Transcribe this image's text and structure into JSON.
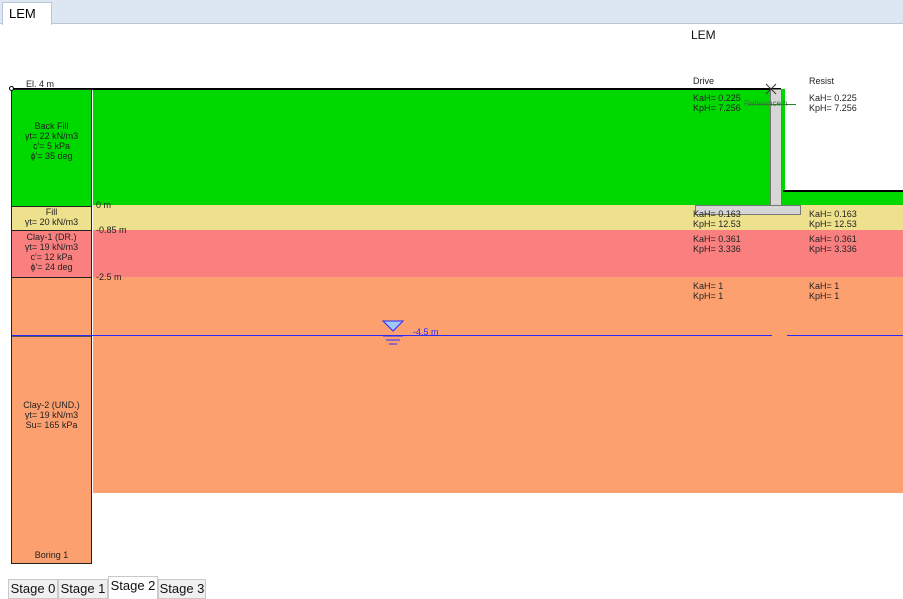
{
  "window": {
    "tab_title": "LEM"
  },
  "canvas": {
    "title": "LEM",
    "elevation_label": "El. 4 m",
    "drive_header": "Drive",
    "resist_header": "Resist",
    "wall_label": "Reference h",
    "water_level_label": "-4.5 m",
    "depth_labels": [
      "0 m",
      "-0.85 m",
      "-2.5 m"
    ],
    "layers": [
      {
        "name": "Back Fill",
        "props": [
          "γt= 22 kN/m3",
          "c'= 5 kPa",
          "ϕ'= 35 deg"
        ],
        "color": "#00d900"
      },
      {
        "name": "Fill",
        "props": [
          "γt= 20 kN/m3"
        ],
        "color": "#ede18d"
      },
      {
        "name": "Clay-1 (DR.)",
        "props": [
          "γt= 19 kN/m3",
          "c'= 12 kPa",
          "ϕ'= 24 deg"
        ],
        "color": "#fa8080"
      },
      {
        "name": "Clay-2 (UND.)",
        "props": [
          "γt= 19 kN/m3",
          "Su= 165 kPa"
        ],
        "color": "#fda070"
      }
    ],
    "boring_label": "Boring 1",
    "coefficients": [
      {
        "drive": [
          "KaH= 0.225",
          "KpH= 7.256"
        ],
        "resist": [
          "KaH= 0.225",
          "KpH= 7.256"
        ]
      },
      {
        "drive": [
          "KaH= 0.163",
          "KpH= 12.53"
        ],
        "resist": [
          "KaH= 0.163",
          "KpH= 12.53"
        ]
      },
      {
        "drive": [
          "KaH= 0.361",
          "KpH= 3.336"
        ],
        "resist": [
          "KaH= 0.361",
          "KpH= 3.336"
        ]
      },
      {
        "drive": [
          "KaH= 1",
          "KpH= 1"
        ],
        "resist": [
          "KaH= 1",
          "KpH= 1"
        ]
      }
    ]
  },
  "stage_tabs": [
    {
      "label": "Stage 0",
      "active": false
    },
    {
      "label": "Stage 1",
      "active": false
    },
    {
      "label": "Stage 2",
      "active": true
    },
    {
      "label": "Stage 3",
      "active": false
    }
  ]
}
